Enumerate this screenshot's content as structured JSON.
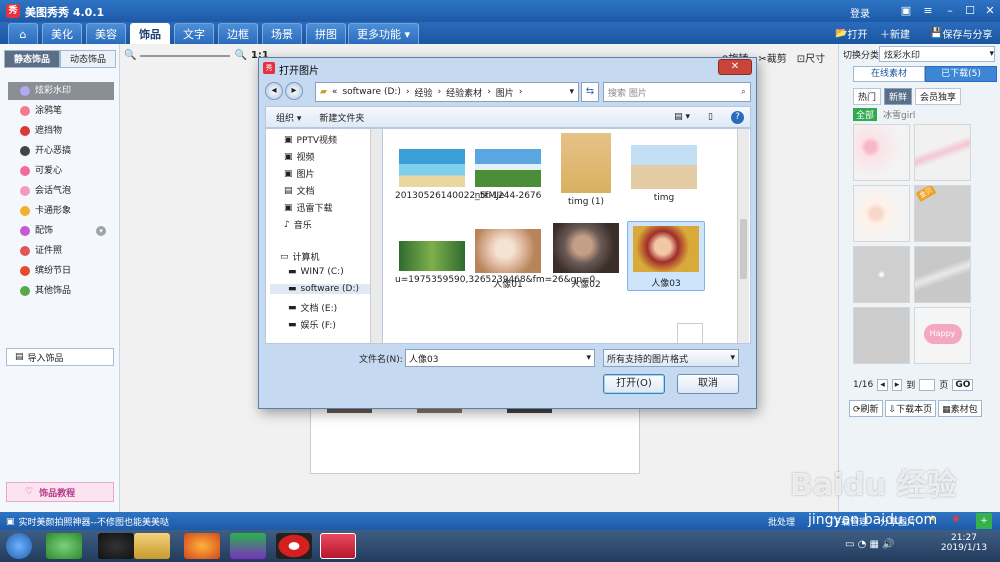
{
  "app": {
    "title": "美图秀秀 4.0.1",
    "logo_text": "秀",
    "login": "登录"
  },
  "menu": {
    "home_icon": "home-icon",
    "tabs": [
      "美化",
      "美容",
      "饰品",
      "文字",
      "边框",
      "场景",
      "拼图",
      "更多功能"
    ],
    "active_tab": "饰品",
    "open": "打开",
    "new": "新建",
    "save_share": "保存与分享"
  },
  "left_panel": {
    "tabs": [
      "静态饰品",
      "动态饰品"
    ],
    "items": [
      "炫彩水印",
      "涂鸦笔",
      "遮挡物",
      "开心恶搞",
      "可爱心",
      "会话气泡",
      "卡通形象",
      "配饰",
      "证件照",
      "缤纷节日",
      "其他饰品"
    ],
    "selected": "炫彩水印",
    "import": "导入饰品",
    "tutorial": "饰品教程"
  },
  "canvas_toolbar": {
    "zoom_label": "1:1",
    "crop": "裁剪",
    "size": "尺寸",
    "rotate": "旋转"
  },
  "right_panel": {
    "category_label": "切换分类",
    "category_value": "炫彩水印",
    "tabs": [
      "在线素材",
      "已下载(5)"
    ],
    "filters": [
      "热门",
      "新鲜",
      "会员独享"
    ],
    "subfilters": [
      "全部",
      "冰雪girl"
    ],
    "thumb_badge": "金贝",
    "thumb_text": "Happy",
    "page_info": "1/16",
    "goto_label": "到",
    "page_unit": "页",
    "go": "GO",
    "refresh": "刷新",
    "download_page": "下载本页",
    "material_pack": "素材包"
  },
  "status_bar": {
    "message": "实时美颜拍照神器--不修图也能美美哒",
    "batch": "批处理",
    "download_mgr": "下载管理",
    "share": "分享图片"
  },
  "taskbar": {
    "time": "21:27",
    "date": "2019/1/13"
  },
  "dialog": {
    "title": "打开图片",
    "breadcrumb": [
      "software (D:)",
      "经验",
      "经验素材",
      "图片"
    ],
    "search_placeholder": "搜索 图片",
    "organize": "组织",
    "new_folder": "新建文件夹",
    "nav": [
      "PPTV视频",
      "视频",
      "图片",
      "文档",
      "迅雷下载",
      "音乐",
      "计算机",
      "WIN7 (C:)",
      "software (D:)",
      "文档 (E:)",
      "娱乐 (F:)"
    ],
    "files": [
      {
        "name": "20130526140022_5fMJe",
        "colors": [
          "#3a9fd6",
          "#7fd0ef",
          "#e8d8a0"
        ]
      },
      {
        "name": "ntk-1244-2676",
        "colors": [
          "#5aa6e0",
          "#4b8e3a",
          "#e6f0f7"
        ]
      },
      {
        "name": "timg (1)",
        "colors": [
          "#e7c289",
          "#d9b060",
          "#3a3030"
        ]
      },
      {
        "name": "timg",
        "colors": [
          "#c3dff3",
          "#e3cba3",
          "#d9453a"
        ]
      },
      {
        "name": "u=1975359590,3265239468&fm=26&gp=0",
        "colors": [
          "#2f6b2f",
          "#7fb04c",
          "#d6b36e"
        ]
      },
      {
        "name": "人像01",
        "colors": [
          "#e8c6b0",
          "#b8845a",
          "#f3e3d2"
        ]
      },
      {
        "name": "人像02",
        "colors": [
          "#3a2e2a",
          "#c49f88",
          "#6a5a55"
        ]
      },
      {
        "name": "人像03",
        "colors": [
          "#d9a93a",
          "#a02c2c",
          "#f2c7a5"
        ]
      }
    ],
    "selected_file": "人像03",
    "filename_label": "文件名(N):",
    "filename_value": "人像03",
    "filetype": "所有支持的图片格式",
    "open_button": "打开(O)",
    "cancel_button": "取消"
  },
  "watermark": {
    "brand": "Baidu 经验",
    "url": "jingyan.baidu.com"
  }
}
